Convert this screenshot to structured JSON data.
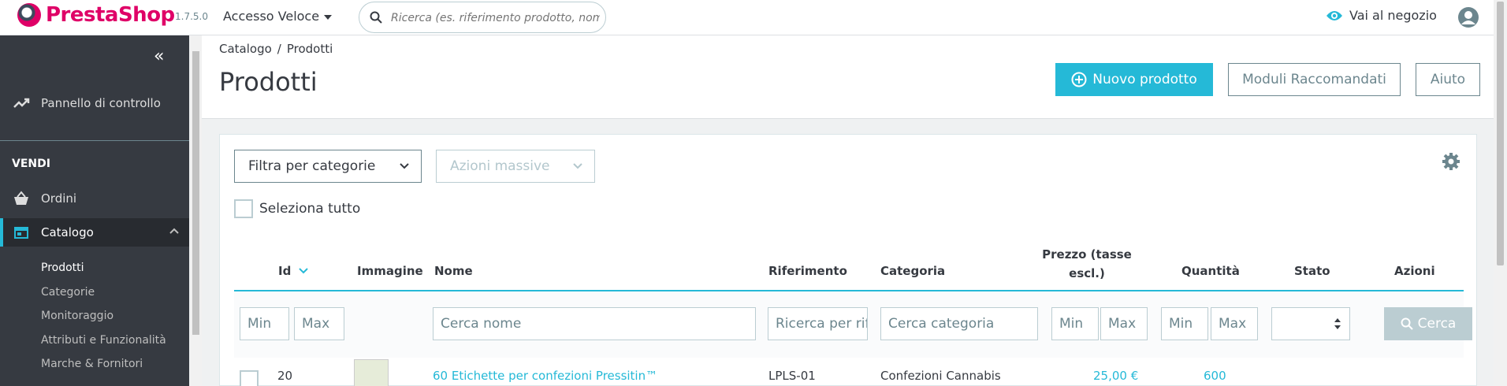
{
  "header": {
    "brand": "PrestaShop",
    "version": "1.7.5.0",
    "quick_access": "Accesso Veloce",
    "search_placeholder": "Ricerca (es. riferimento prodotto, nome cliente...)",
    "shop_link": "Vai al negozio"
  },
  "sidebar": {
    "dashboard": "Pannello di controllo",
    "section": "VENDI",
    "orders": "Ordini",
    "catalog": "Catalogo",
    "sub_items": [
      "Prodotti",
      "Categorie",
      "Monitoraggio",
      "Attributi e Funzionalità",
      "Marche & Fornitori"
    ]
  },
  "page": {
    "breadcrumb": [
      "Catalogo",
      "Prodotti"
    ],
    "title": "Prodotti",
    "buttons": {
      "new": "Nuovo prodotto",
      "modules": "Moduli Raccomandati",
      "help": "Aiuto"
    }
  },
  "toolbar": {
    "category_filter": "Filtra per categorie",
    "bulk_actions": "Azioni massive",
    "select_all": "Seleziona tutto"
  },
  "table": {
    "headers": {
      "id": "Id",
      "image": "Immagine",
      "name": "Nome",
      "reference": "Riferimento",
      "category": "Categoria",
      "price_line1": "Prezzo (tasse",
      "price_line2": "escl.)",
      "quantity": "Quantità",
      "status": "Stato",
      "actions": "Azioni"
    },
    "filters": {
      "min": "Min",
      "max": "Max",
      "name": "Cerca nome",
      "reference": "Ricerca per riferimento",
      "category": "Cerca categoria",
      "search_button": "Cerca"
    },
    "rows": [
      {
        "id": "20",
        "name": "60 Etichette per confezioni Pressitin™",
        "reference": "LPLS-01",
        "category": "Confezioni Cannabis",
        "price": "25,00 €",
        "quantity": "600"
      }
    ]
  },
  "colors": {
    "accent": "#25b9d7",
    "brand": "#df0067",
    "sidebar": "#363a41"
  }
}
